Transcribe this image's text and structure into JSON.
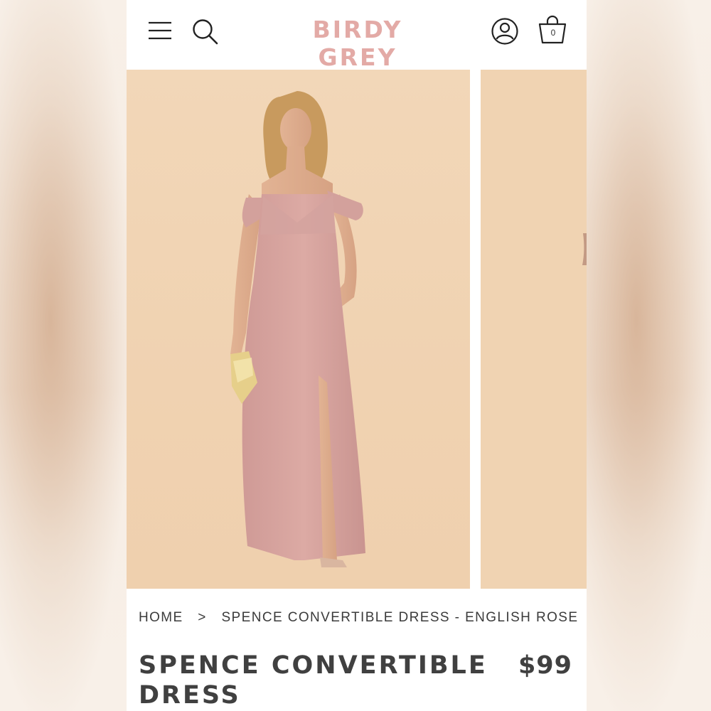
{
  "header": {
    "brand": "BIRDY GREY",
    "bag_count": "0",
    "icons": [
      "menu-icon",
      "search-icon",
      "account-icon",
      "shopping-bag-icon"
    ],
    "brand_color": "#e3aaa6"
  },
  "gallery": {
    "background_color": "#f0d3b2",
    "dress_color": "#d9a7a2"
  },
  "breadcrumb": {
    "home": "HOME",
    "separator": ">",
    "current": "SPENCE CONVERTIBLE DRESS - ENGLISH ROSE"
  },
  "product": {
    "title": "SPENCE CONVERTIBLE DRESS",
    "price": "$99"
  }
}
